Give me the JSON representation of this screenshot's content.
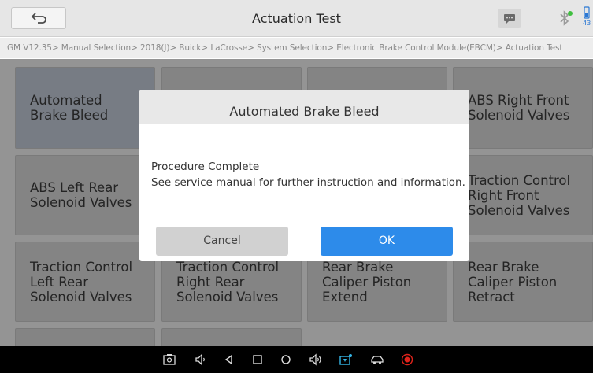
{
  "header": {
    "title": "Actuation Test",
    "back_icon": "back-arrow-icon",
    "message_icon": "chat-icon",
    "bluetooth_icon": "bluetooth-icon",
    "battery_percent": "43"
  },
  "breadcrumb": "GM V12.35> Manual Selection> 2018(J)> Buick> LaCrosse> System Selection> Electronic Brake Control Module(EBCM)> Actuation Test",
  "tiles": [
    "Automated\nBrake Bleed",
    "",
    "",
    "ABS Right Front\nSolenoid Valves",
    "ABS Left Rear\nSolenoid Valves",
    "",
    "",
    "Traction Control\nRight Front\nSolenoid Valves",
    "Traction Control\nLeft Rear\nSolenoid Valves",
    "Traction Control\nRight Rear\nSolenoid Valves",
    "Rear Brake\nCaliper Piston\nExtend",
    "Rear Brake\nCaliper Piston\nRetract"
  ],
  "dialog": {
    "title": "Automated Brake Bleed",
    "line1": "Procedure Complete",
    "line2": "See service manual for further instruction and information.",
    "cancel_label": "Cancel",
    "ok_label": "OK"
  },
  "navbar": {
    "icons": [
      "screenshot-icon",
      "volume-down-icon",
      "back-icon",
      "recent-apps-icon",
      "home-icon",
      "volume-up-icon",
      "vci-icon",
      "car-icon",
      "record-icon"
    ]
  },
  "colors": {
    "accent": "#2d8bea",
    "record": "#e0231b"
  }
}
